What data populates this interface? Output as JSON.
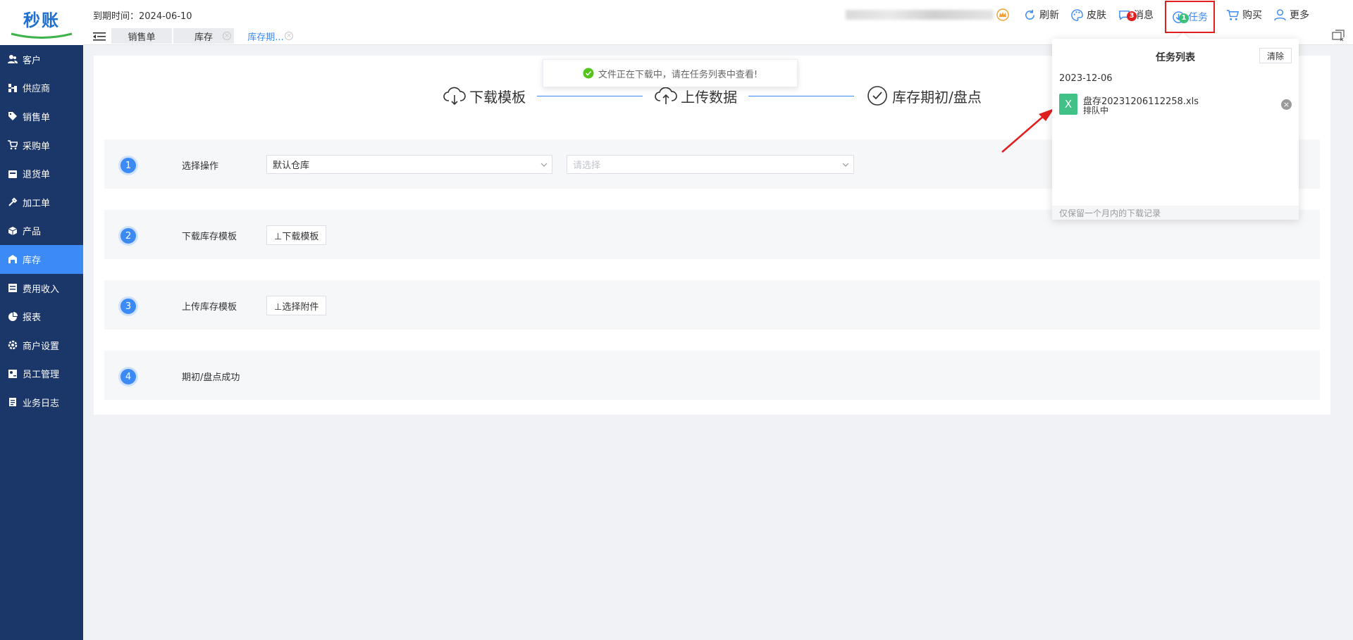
{
  "app": {
    "logo_text": "秒账"
  },
  "header": {
    "expire_text": "到期时间：2024-06-10",
    "buttons": {
      "refresh": "刷新",
      "skin": "皮肤",
      "message": "消息",
      "message_badge": "3",
      "task": "任务",
      "task_badge": "1",
      "buy": "购买",
      "more": "更多"
    }
  },
  "tabs": [
    {
      "label": "销售单"
    },
    {
      "label": "库存"
    },
    {
      "label": "库存期..."
    }
  ],
  "sidebar": {
    "items": [
      {
        "label": "客户",
        "icon": "users-icon"
      },
      {
        "label": "供应商",
        "icon": "supplier-icon"
      },
      {
        "label": "销售单",
        "icon": "tag-icon"
      },
      {
        "label": "采购单",
        "icon": "cart-icon"
      },
      {
        "label": "退货单",
        "icon": "return-icon"
      },
      {
        "label": "加工单",
        "icon": "tool-icon"
      },
      {
        "label": "产品",
        "icon": "box-icon"
      },
      {
        "label": "库存",
        "icon": "warehouse-icon",
        "active": true
      },
      {
        "label": "费用收入",
        "icon": "finance-icon"
      },
      {
        "label": "报表",
        "icon": "pie-icon"
      },
      {
        "label": "商户设置",
        "icon": "gear-icon"
      },
      {
        "label": "员工管理",
        "icon": "staff-icon"
      },
      {
        "label": "业务日志",
        "icon": "log-icon"
      }
    ]
  },
  "steps": [
    {
      "label": "下载模板",
      "icon": "cloud-download-icon"
    },
    {
      "label": "上传数据",
      "icon": "cloud-upload-icon"
    },
    {
      "label": "库存期初/盘点",
      "icon": "check-circle-icon"
    }
  ],
  "rows": [
    {
      "num": "1",
      "label": "选择操作",
      "select1": "默认仓库",
      "select2_placeholder": "请选择"
    },
    {
      "num": "2",
      "label": "下载库存模板",
      "button": "⊥下载模板"
    },
    {
      "num": "3",
      "label": "上传库存模板",
      "button": "⊥选择附件"
    },
    {
      "num": "4",
      "label": "期初/盘点成功"
    }
  ],
  "toast": {
    "text": "文件正在下载中，请在任务列表中查看!"
  },
  "task_popover": {
    "title": "任务列表",
    "clear_label": "清除",
    "date": "2023-12-06",
    "file_icon_letter": "X",
    "file_name": "盘存20231206112258.xls",
    "file_status": "排队中",
    "footer": "仅保留一个月内的下载记录"
  },
  "colors": {
    "sidebar": "#1b3668",
    "accent": "#3b8af5",
    "highlight_border": "#e02020",
    "xls": "#3fc188"
  }
}
